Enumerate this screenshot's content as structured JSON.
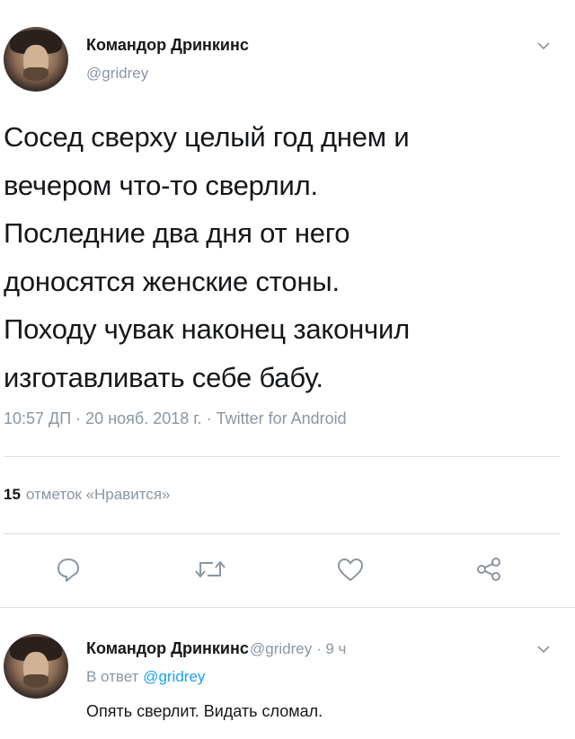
{
  "main_tweet": {
    "author_name": "Командор Дринкинс",
    "author_handle": "@gridrey",
    "text": "Сосед сверху целый год днем и\nвечером что-то сверлил.\nПоследние два дня от него\nдоносятся женские стоны.\nПоходу чувак наконец закончил\nизготавливать себе бабу.",
    "meta": "10:57 ДП · 20 нояб. 2018 г. · Twitter for Android",
    "likes_count": "15",
    "likes_label": "отметок «Нравится»"
  },
  "actions": [
    {
      "icon": "reply-icon"
    },
    {
      "icon": "retweet-icon"
    },
    {
      "icon": "like-icon"
    },
    {
      "icon": "share-icon"
    }
  ],
  "reply_tweet": {
    "author_name": "Командор Дринкинс",
    "author_handle": "@gridrey",
    "time": "· 9 ч",
    "in_reply_prefix": "В ответ",
    "in_reply_mention": "@gridrey",
    "text": "Опять сверлит. Видать сломал."
  },
  "colors": {
    "text": "#14171a",
    "secondary": "#8a96a3",
    "link": "#1da1f2",
    "divider": "#d9dee3"
  }
}
